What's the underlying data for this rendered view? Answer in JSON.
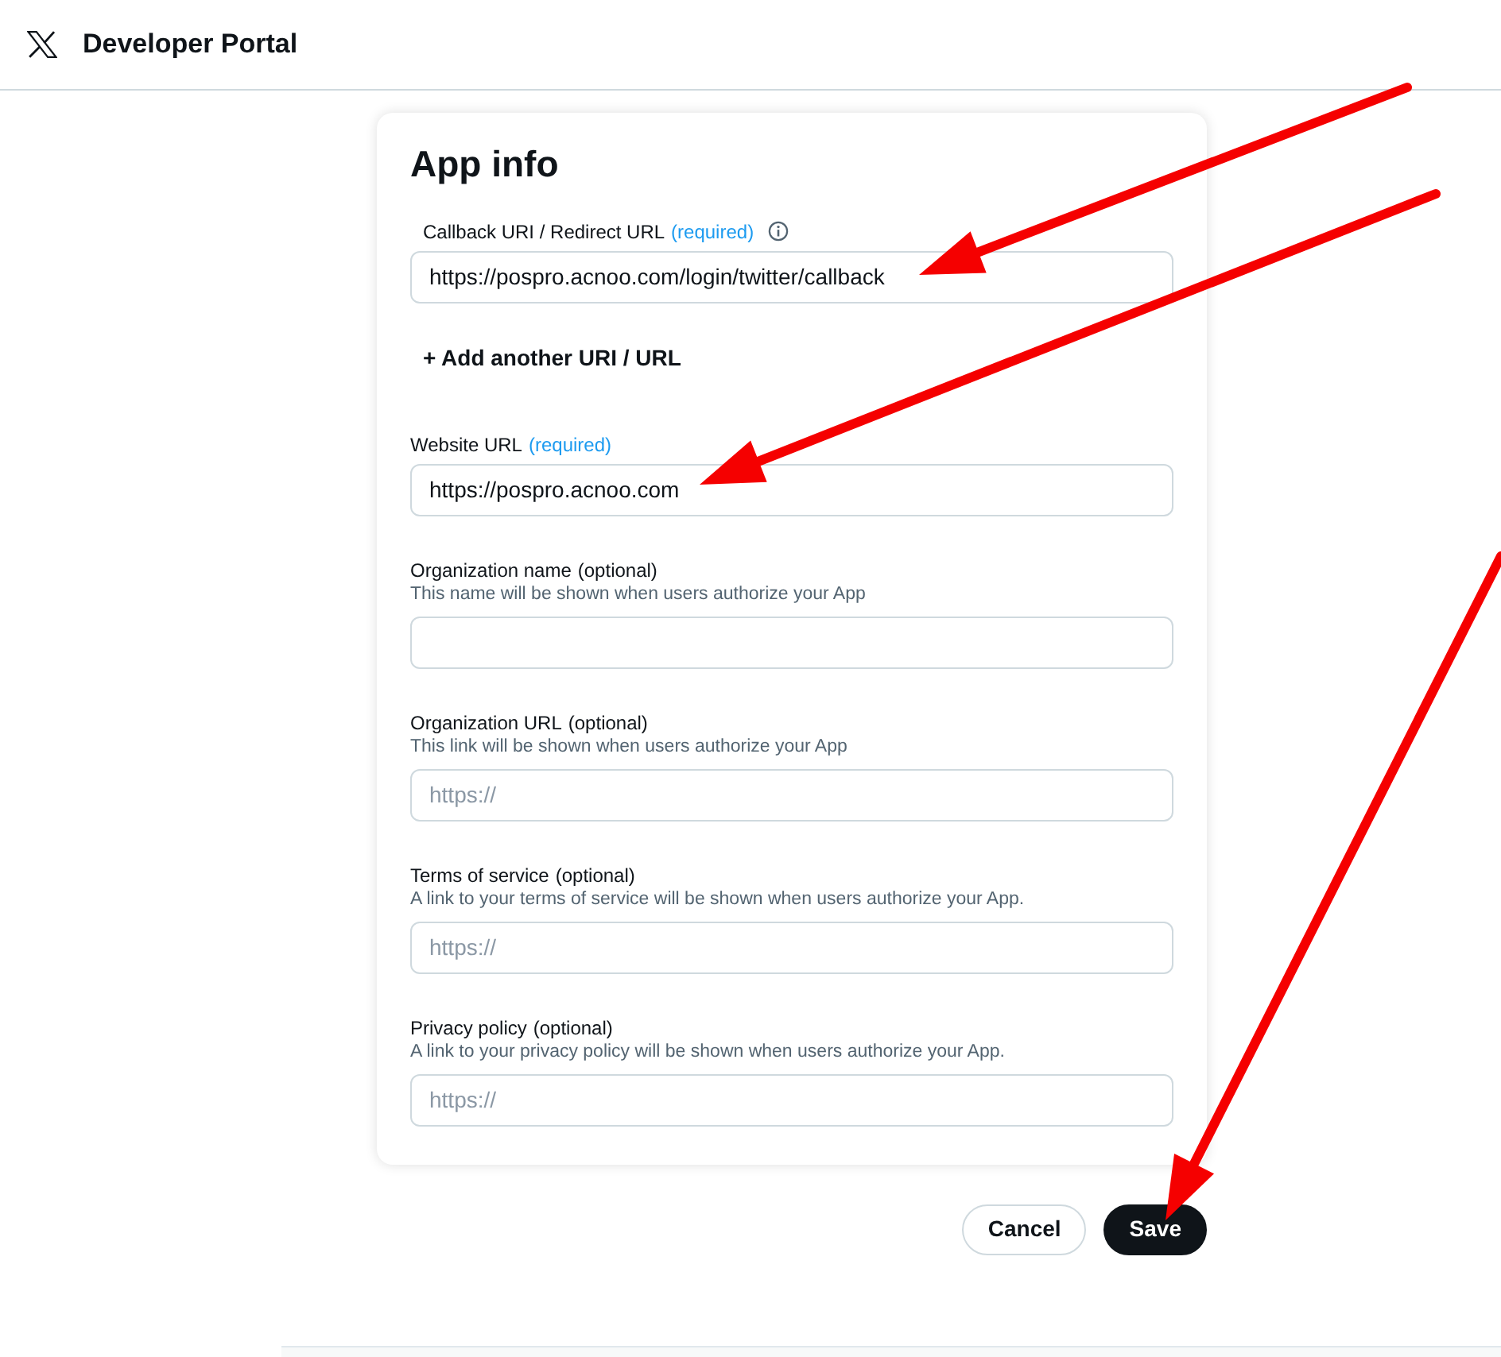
{
  "header": {
    "title": "Developer Portal"
  },
  "card": {
    "title": "App info",
    "fields": [
      {
        "label": "Callback URI / Redirect URL",
        "qualifier": "(required)",
        "kind": "required",
        "info": true,
        "value": "https://pospro.acnoo.com/login/twitter/callback",
        "add_link": "+ Add another URI / URL"
      },
      {
        "label": "Website URL",
        "qualifier": "(required)",
        "kind": "required",
        "value": "https://pospro.acnoo.com"
      },
      {
        "label": "Organization name",
        "qualifier": "(optional)",
        "kind": "optional",
        "hint": "This name will be shown when users authorize your App"
      },
      {
        "label": "Organization URL",
        "qualifier": "(optional)",
        "kind": "optional",
        "hint": "This link will be shown when users authorize your App",
        "placeholder": "https://"
      },
      {
        "label": "Terms of service",
        "qualifier": "(optional)",
        "kind": "optional",
        "hint": "A link to your terms of service will be shown when users authorize your App.",
        "placeholder": "https://"
      },
      {
        "label": "Privacy policy",
        "qualifier": "(optional)",
        "kind": "optional",
        "hint": "A link to your privacy policy will be shown when users authorize your App.",
        "placeholder": "https://"
      }
    ]
  },
  "buttons": [
    {
      "label": "Cancel",
      "kind": "secondary"
    },
    {
      "label": "Save",
      "kind": "primary"
    }
  ],
  "annotations": [
    {
      "kind": "arrow"
    },
    {
      "kind": "arrow"
    },
    {
      "kind": "arrow"
    }
  ]
}
